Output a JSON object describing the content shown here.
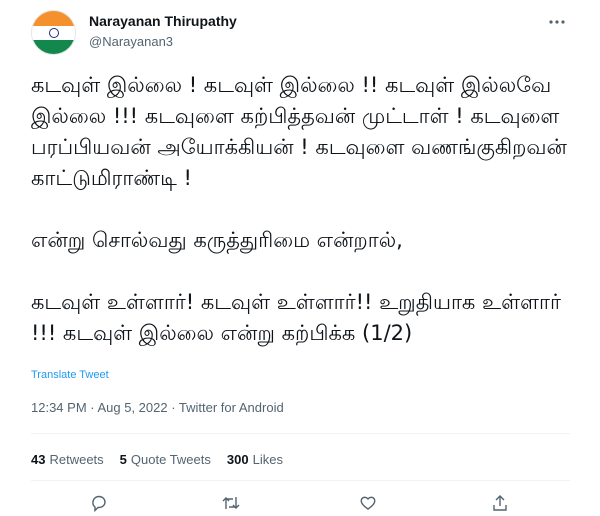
{
  "user": {
    "display_name": "Narayanan Thirupathy",
    "handle": "@Narayanan3"
  },
  "tweet": {
    "paragraphs": [
      "கடவுள் இல்லை ! கடவுள் இல்லை !! கடவுள் இல்லவே இல்லை !!! கடவுளை கற்பித்தவன் முட்டாள் ! கடவுளை பரப்பியவன் அயோக்கியன் ! கடவுளை வணங்குகிறவன் காட்டுமிராண்டி !",
      "என்று சொல்வது கருத்துரிமை என்றால்,",
      "கடவுள் உள்ளார்! கடவுள் உள்ளார்!! உறுதியாக உள்ளார் !!! கடவுள் இல்லை என்று கற்பிக்க (1/2)"
    ],
    "translate_label": "Translate Tweet",
    "timestamp": "12:34 PM · Aug 5, 2022 · Twitter for Android"
  },
  "stats": {
    "retweets_count": "43",
    "retweets_label": "Retweets",
    "quotes_count": "5",
    "quotes_label": "Quote Tweets",
    "likes_count": "300",
    "likes_label": "Likes"
  },
  "icons": {
    "more": "more-options-icon",
    "reply": "reply-icon",
    "retweet": "retweet-icon",
    "like": "like-icon",
    "share": "share-icon"
  },
  "colors": {
    "link": "#1d9bf0",
    "muted": "#536471",
    "text": "#0f1419",
    "divider": "#eff3f4"
  }
}
